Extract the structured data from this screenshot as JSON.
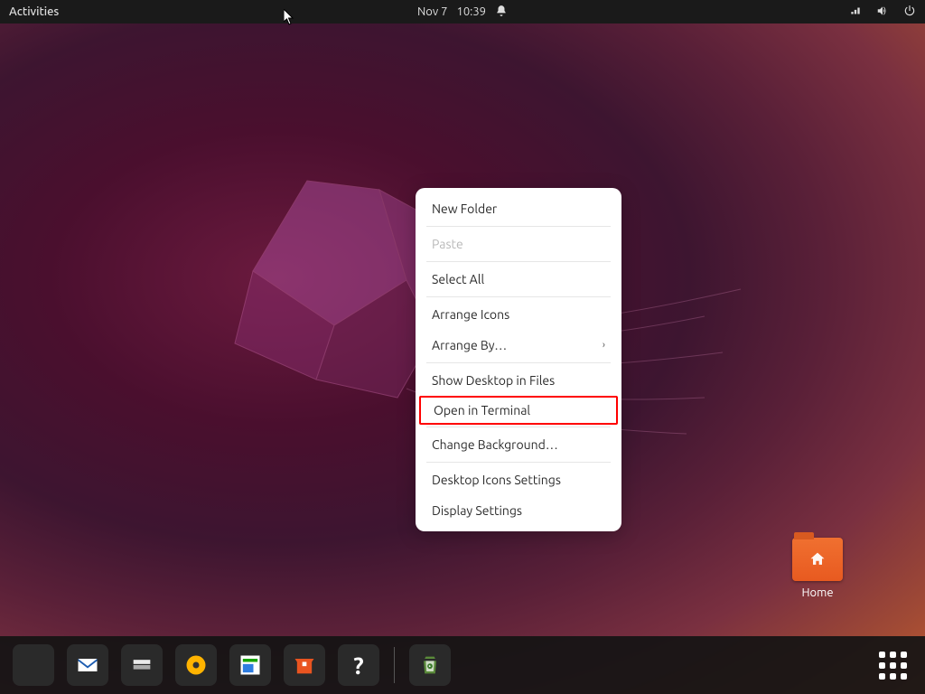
{
  "topbar": {
    "activities": "Activities",
    "date": "Nov 7",
    "time": "10:39"
  },
  "context_menu": {
    "items": [
      {
        "label": "New Folder",
        "enabled": true
      },
      {
        "label": "Paste",
        "enabled": false
      },
      {
        "label": "Select All",
        "enabled": true
      },
      {
        "label": "Arrange Icons",
        "enabled": true
      },
      {
        "label": "Arrange By…",
        "enabled": true,
        "submenu": true
      },
      {
        "label": "Show Desktop in Files",
        "enabled": true
      },
      {
        "label": "Open in Terminal",
        "enabled": true,
        "highlighted": true
      },
      {
        "label": "Change Background…",
        "enabled": true
      },
      {
        "label": "Desktop Icons Settings",
        "enabled": true
      },
      {
        "label": "Display Settings",
        "enabled": true
      }
    ]
  },
  "desktop": {
    "home_label": "Home"
  },
  "dock": {
    "apps": [
      {
        "name": "firefox",
        "title": "Firefox"
      },
      {
        "name": "thunderbird",
        "title": "Thunderbird"
      },
      {
        "name": "files",
        "title": "Files"
      },
      {
        "name": "rhythmbox",
        "title": "Rhythmbox"
      },
      {
        "name": "libreoffice",
        "title": "LibreOffice Writer"
      },
      {
        "name": "software",
        "title": "Ubuntu Software"
      },
      {
        "name": "help",
        "title": "Help"
      },
      {
        "name": "trash",
        "title": "Trash"
      }
    ]
  }
}
